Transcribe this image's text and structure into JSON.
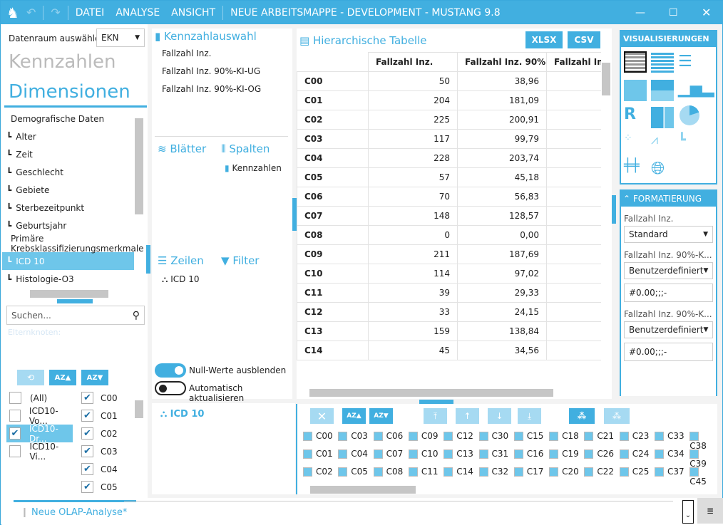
{
  "titlebar": {
    "menu": [
      "DATEI",
      "ANALYSE",
      "ANSICHT"
    ],
    "title": "NEUE ARBEITSMAPPE - DEVELOPMENT - MUSTANG 9.8",
    "accent": "#41afe0"
  },
  "left": {
    "datenraum_label": "Datenraum auswählen",
    "datenraum_value": "EKN",
    "tab_kennzahlen": "Kennzahlen",
    "tab_dimensionen": "Dimensionen",
    "tree": [
      {
        "label": "Demografische Daten",
        "group": true
      },
      {
        "label": "Alter"
      },
      {
        "label": "Zeit"
      },
      {
        "label": "Geschlecht"
      },
      {
        "label": "Gebiete"
      },
      {
        "label": "Sterbezeitpunkt"
      },
      {
        "label": "Geburtsjahr"
      },
      {
        "label": "Primäre Krebsklassifizierungsmerkmale",
        "group": true
      },
      {
        "label": "ICD 10",
        "selected": true
      },
      {
        "label": "Histologie-O3"
      }
    ],
    "search_placeholder": "Suchen...",
    "parent_label": "Elternknoten:",
    "levels": [
      {
        "label": "(All)",
        "checked": false
      },
      {
        "label": "ICD10-Vo...",
        "checked": false
      },
      {
        "label": "ICD10-Dr...",
        "checked": true,
        "selected": true
      },
      {
        "label": "ICD10-Vi...",
        "checked": false
      }
    ],
    "members": [
      "C00",
      "C01",
      "C02",
      "C03",
      "C04",
      "C05"
    ]
  },
  "middle": {
    "kennzahlauswahl": "Kennzahlauswahl",
    "measures": [
      "Fallzahl Inz.",
      "Fallzahl Inz. 90%-KI-UG",
      "Fallzahl Inz. 90%-KI-OG"
    ],
    "blaetter": "Blätter",
    "spalten": "Spalten",
    "spalten_item": "Kennzahlen",
    "zeilen": "Zeilen",
    "filter": "Filter",
    "zeilen_item": "ICD 10",
    "toggle_null": "Null-Werte ausblenden",
    "toggle_null_on": true,
    "toggle_auto": "Automatisch aktualisieren",
    "toggle_auto_on": false
  },
  "table": {
    "title": "Hierarchische Tabelle",
    "xlsx": "XLSX",
    "csv": "CSV",
    "columns": [
      "Fallzahl Inz.",
      "Fallzahl Inz. 90%...",
      "Fallzahl Inz."
    ],
    "rows": [
      [
        "C00",
        "50",
        "38,96"
      ],
      [
        "C01",
        "204",
        "181,09"
      ],
      [
        "C02",
        "225",
        "200,91"
      ],
      [
        "C03",
        "117",
        "99,79"
      ],
      [
        "C04",
        "228",
        "203,74"
      ],
      [
        "C05",
        "57",
        "45,18"
      ],
      [
        "C06",
        "70",
        "56,83"
      ],
      [
        "C07",
        "148",
        "128,57"
      ],
      [
        "C08",
        "0",
        "0,00"
      ],
      [
        "C09",
        "211",
        "187,69"
      ],
      [
        "C10",
        "114",
        "97,02"
      ],
      [
        "C11",
        "39",
        "29,33"
      ],
      [
        "C12",
        "33",
        "24,15"
      ],
      [
        "C13",
        "159",
        "138,84"
      ],
      [
        "C14",
        "45",
        "34,56"
      ]
    ]
  },
  "right": {
    "visualisierungen": "VISUALISIERUNGEN",
    "formatierung": "FORMATIERUNG",
    "formats": [
      {
        "label": "Fallzahl Inz.",
        "value": "Standard"
      },
      {
        "label": "Fallzahl Inz. 90%-K...",
        "value": "Benutzerdefiniert",
        "pattern": "#0.00;;;-"
      },
      {
        "label": "Fallzahl Inz. 90%-K...",
        "value": "Benutzerdefiniert",
        "pattern": "#0.00;;;-"
      }
    ]
  },
  "bottom": {
    "dimension": "ICD 10",
    "members": [
      [
        "C00",
        "C01",
        "C02"
      ],
      [
        "C03",
        "C04",
        "C05"
      ],
      [
        "C06",
        "C07",
        "C08"
      ],
      [
        "C09",
        "C10",
        "C11"
      ],
      [
        "C12",
        "C13",
        "C14"
      ],
      [
        "C30",
        "C31",
        "C32"
      ],
      [
        "C15",
        "C16",
        "C17"
      ],
      [
        "C18",
        "C19",
        "C20"
      ],
      [
        "C21",
        "C26",
        "C22"
      ],
      [
        "C23",
        "C24",
        "C25"
      ],
      [
        "C33",
        "C34",
        "C37"
      ],
      [
        "C38",
        "C39",
        "C45"
      ]
    ]
  },
  "status": {
    "tab": "Neue OLAP-Analyse*"
  }
}
